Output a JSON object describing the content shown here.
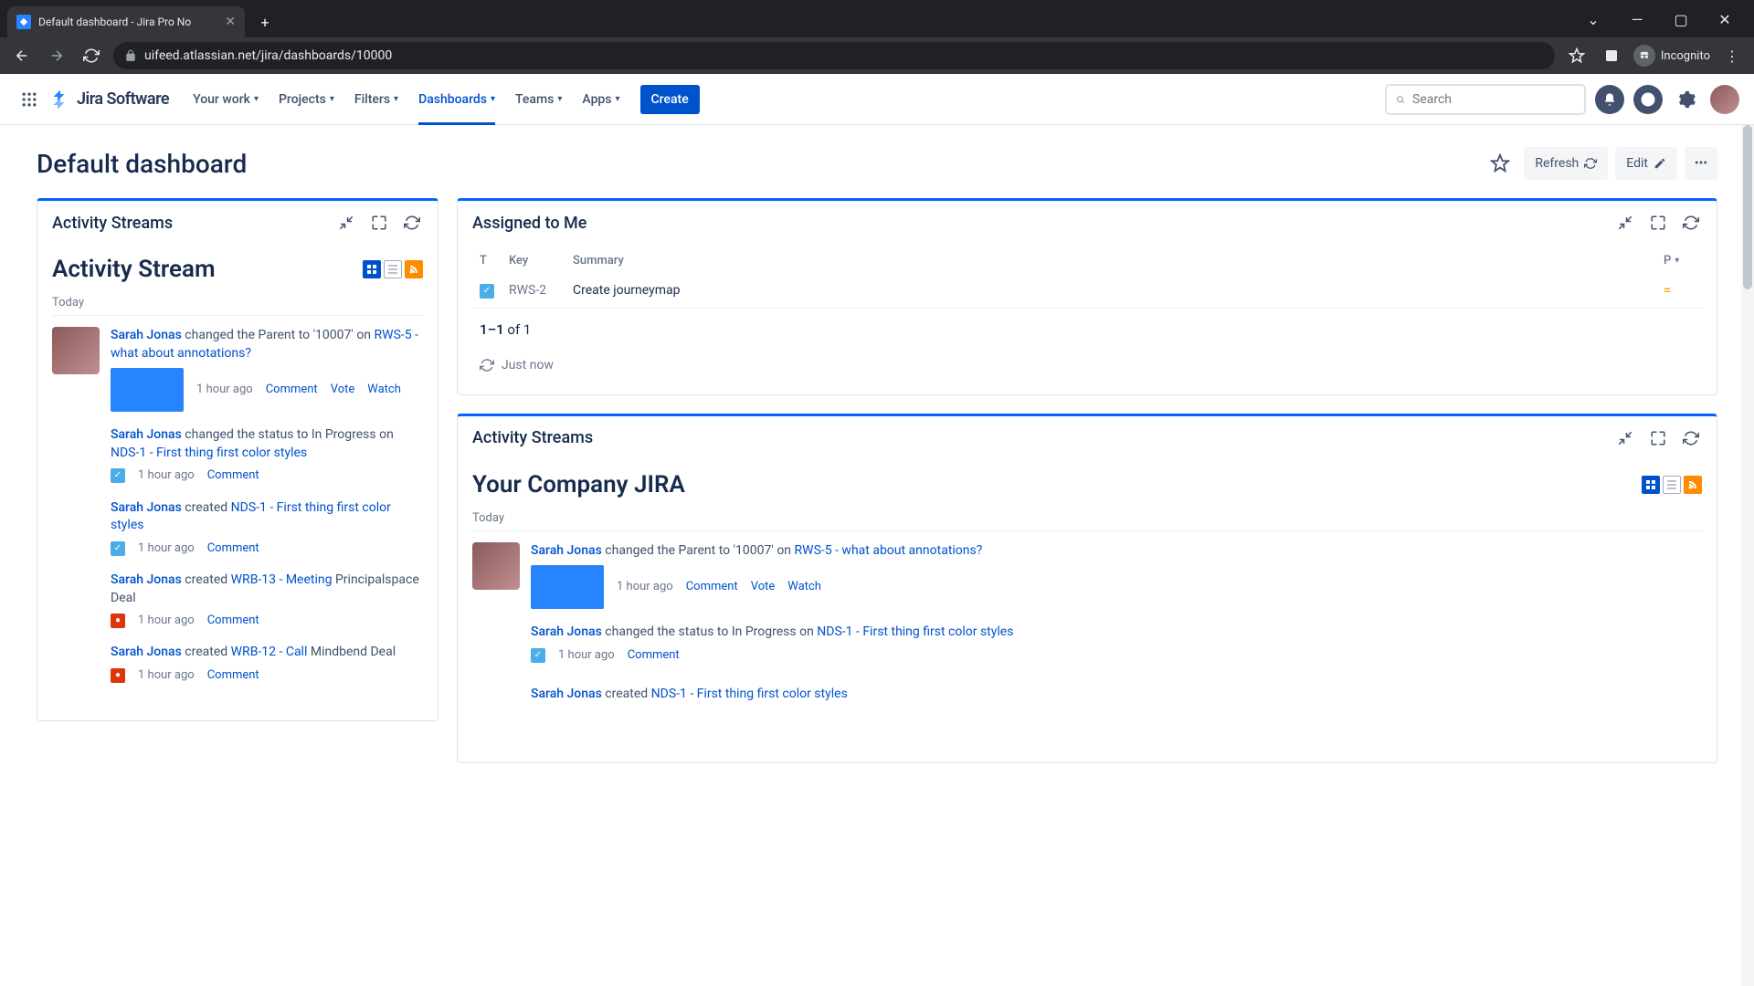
{
  "browser": {
    "tab_title": "Default dashboard - Jira Pro No",
    "url": "uifeed.atlassian.net/jira/dashboards/10000",
    "incognito_label": "Incognito"
  },
  "header": {
    "product": "Jira Software",
    "nav": {
      "your_work": "Your work",
      "projects": "Projects",
      "filters": "Filters",
      "dashboards": "Dashboards",
      "teams": "Teams",
      "apps": "Apps"
    },
    "create": "Create",
    "search_placeholder": "Search"
  },
  "page": {
    "title": "Default dashboard",
    "refresh": "Refresh",
    "edit": "Edit"
  },
  "gadget_activity_left": {
    "title": "Activity Streams",
    "stream_title": "Activity Stream",
    "day": "Today",
    "items": [
      {
        "user": "Sarah Jonas",
        "text_before": " changed the Parent to '10007' on ",
        "link": "RWS-5 - what about annotations?",
        "text_after": "",
        "time": "1 hour ago",
        "icon": "page",
        "actions": [
          "Comment",
          "Vote",
          "Watch"
        ],
        "avatar": true
      },
      {
        "user": "Sarah Jonas",
        "text_before": " changed the status to In Progress on ",
        "link": "NDS-1 - First thing first color styles",
        "text_after": "",
        "time": "1 hour ago",
        "icon": "task",
        "actions": [
          "Comment"
        ],
        "avatar": false
      },
      {
        "user": "Sarah Jonas",
        "text_before": " created ",
        "link": "NDS-1 - First thing first color styles",
        "text_after": "",
        "time": "1 hour ago",
        "icon": "task",
        "actions": [
          "Comment"
        ],
        "avatar": false
      },
      {
        "user": "Sarah Jonas",
        "text_before": " created ",
        "link": "WRB-13 - Meeting",
        "text_after": " Principalspace Deal",
        "time": "1 hour ago",
        "icon": "bug",
        "actions": [
          "Comment"
        ],
        "avatar": false
      },
      {
        "user": "Sarah Jonas",
        "text_before": " created ",
        "link": "WRB-12 - Call",
        "text_after": " Mindbend Deal",
        "time": "1 hour ago",
        "icon": "bug",
        "actions": [
          "Comment"
        ],
        "avatar": false
      }
    ]
  },
  "gadget_assigned": {
    "title": "Assigned to Me",
    "columns": {
      "t": "T",
      "key": "Key",
      "summary": "Summary",
      "p": "P"
    },
    "rows": [
      {
        "key": "RWS-2",
        "summary": "Create journeymap",
        "priority": "medium"
      }
    ],
    "pager_range": "1–1",
    "pager_of": " of ",
    "pager_total": "1",
    "refreshed": "Just now"
  },
  "gadget_activity_right": {
    "title": "Activity Streams",
    "stream_title": "Your Company JIRA",
    "day": "Today",
    "items": [
      {
        "user": "Sarah Jonas",
        "text_before": " changed the Parent to '10007' on ",
        "link": "RWS-5 - what about annotations?",
        "text_after": "",
        "time": "1 hour ago",
        "icon": "page",
        "actions": [
          "Comment",
          "Vote",
          "Watch"
        ],
        "avatar": true
      },
      {
        "user": "Sarah Jonas",
        "text_before": " changed the status to In Progress on ",
        "link": "NDS-1 - First thing first color styles",
        "text_after": "",
        "time": "1 hour ago",
        "icon": "task",
        "actions": [
          "Comment"
        ],
        "avatar": false
      },
      {
        "user": "Sarah Jonas",
        "text_before": " created ",
        "link": "NDS-1 - First thing first color styles",
        "text_after": "",
        "time": "",
        "icon": "",
        "actions": [],
        "avatar": false
      }
    ]
  }
}
